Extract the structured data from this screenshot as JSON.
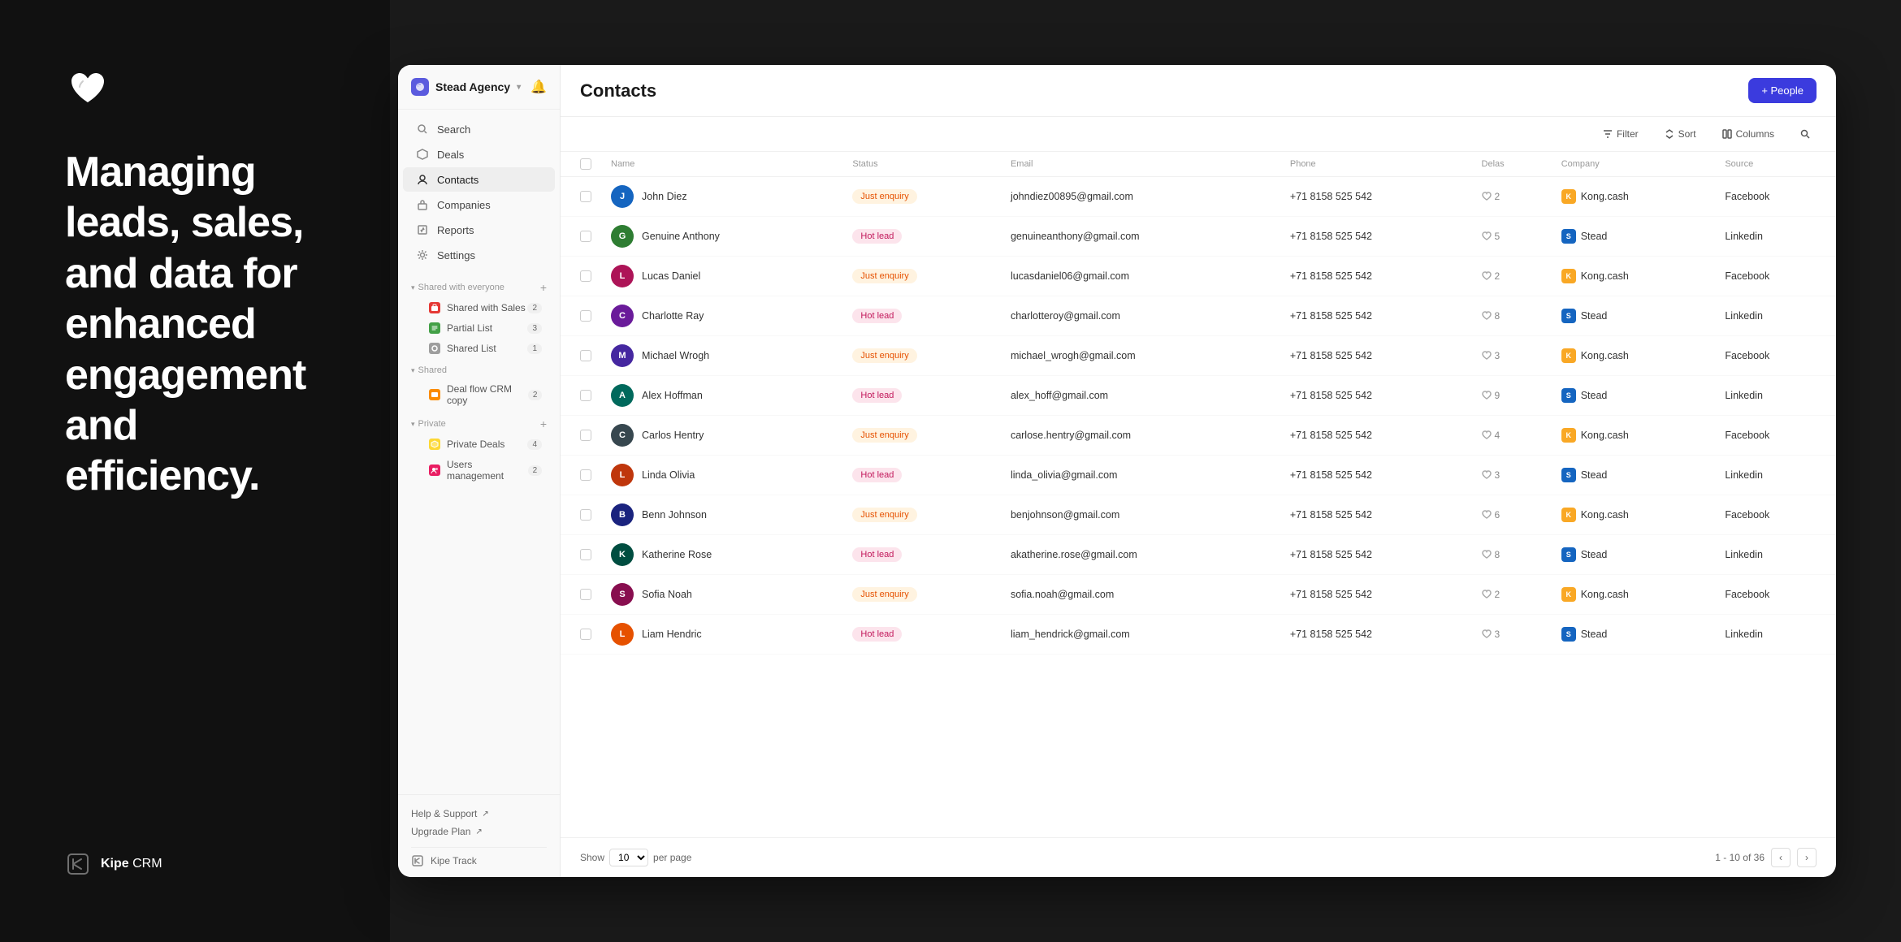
{
  "background": {
    "tagline": "Managing leads, sales, and data for enhanced engagement and efficiency.",
    "brand_name_bold": "Kipe",
    "brand_name_rest": " CRM"
  },
  "sidebar": {
    "brand": "Stead Agency",
    "brand_chevron": "▾",
    "nav_items": [
      {
        "id": "search",
        "label": "Search",
        "icon": "🔍"
      },
      {
        "id": "deals",
        "label": "Deals",
        "icon": "💎"
      },
      {
        "id": "contacts",
        "label": "Contacts",
        "icon": "👤",
        "active": true
      },
      {
        "id": "companies",
        "label": "Companies",
        "icon": "🏢"
      },
      {
        "id": "reports",
        "label": "Reports",
        "icon": "⚙️"
      },
      {
        "id": "settings",
        "label": "Settings",
        "icon": "⚙️"
      }
    ],
    "sections": [
      {
        "id": "shared-everyone",
        "label": "Shared with everyone",
        "items": [
          {
            "id": "shared-with-sales",
            "label": "Shared with Sales",
            "color": "#e53935",
            "badge": "2"
          },
          {
            "id": "partial-list",
            "label": "Partial List",
            "color": "#43a047",
            "badge": "3"
          },
          {
            "id": "shared-list",
            "label": "Shared List",
            "color": "#757575",
            "badge": "1"
          }
        ]
      },
      {
        "id": "shared",
        "label": "Shared",
        "items": [
          {
            "id": "deal-flow-crm",
            "label": "Deal flow CRM copy",
            "color": "#fb8c00",
            "badge": "2"
          }
        ]
      },
      {
        "id": "private",
        "label": "Private",
        "items": [
          {
            "id": "private-deals",
            "label": "Private Deals",
            "color": "#fdd835",
            "badge": "4"
          },
          {
            "id": "users-management",
            "label": "Users management",
            "color": "#e91e63",
            "badge": "2"
          }
        ]
      }
    ],
    "footer_links": [
      {
        "label": "Help & Support",
        "icon": "↗"
      },
      {
        "label": "Upgrade Plan",
        "icon": "↗"
      }
    ],
    "kipe_track_label": "Kipe Track"
  },
  "main": {
    "title": "Contacts",
    "add_button_label": "+ People",
    "toolbar": {
      "filter_label": "Filter",
      "sort_label": "Sort",
      "columns_label": "Columns"
    },
    "table": {
      "columns": [
        "Name",
        "Status",
        "Email",
        "Phone",
        "Delas",
        "Company",
        "Source"
      ],
      "rows": [
        {
          "name": "John Diez",
          "initial": "J",
          "color": "#1565c0",
          "status": "Just enquiry",
          "status_type": "just-enquiry",
          "email": "johndiez00895@gmail.com",
          "phone": "+71 8158 525 542",
          "delas": "2",
          "company": "Kong.cash",
          "company_color": "#f9a825",
          "source": "Facebook"
        },
        {
          "name": "Genuine Anthony",
          "initial": "G",
          "color": "#2e7d32",
          "status": "Hot lead",
          "status_type": "hot-lead",
          "email": "genuineanthony@gmail.com",
          "phone": "+71 8158 525 542",
          "delas": "5",
          "company": "Stead",
          "company_color": "#1565c0",
          "source": "Linkedin"
        },
        {
          "name": "Lucas Daniel",
          "initial": "L",
          "color": "#ad1457",
          "status": "Just enquiry",
          "status_type": "just-enquiry",
          "email": "lucasdaniel06@gmail.com",
          "phone": "+71 8158 525 542",
          "delas": "2",
          "company": "Kong.cash",
          "company_color": "#f9a825",
          "source": "Facebook"
        },
        {
          "name": "Charlotte Ray",
          "initial": "C",
          "color": "#6a1b9a",
          "status": "Hot lead",
          "status_type": "hot-lead",
          "email": "charlotteroy@gmail.com",
          "phone": "+71 8158 525 542",
          "delas": "8",
          "company": "Stead",
          "company_color": "#1565c0",
          "source": "Linkedin"
        },
        {
          "name": "Michael Wrogh",
          "initial": "M",
          "color": "#4527a0",
          "status": "Just enquiry",
          "status_type": "just-enquiry",
          "email": "michael_wrogh@gmail.com",
          "phone": "+71 8158 525 542",
          "delas": "3",
          "company": "Kong.cash",
          "company_color": "#f9a825",
          "source": "Facebook"
        },
        {
          "name": "Alex Hoffman",
          "initial": "A",
          "color": "#00695c",
          "status": "Hot lead",
          "status_type": "hot-lead",
          "email": "alex_hoff@gmail.com",
          "phone": "+71 8158 525 542",
          "delas": "9",
          "company": "Stead",
          "company_color": "#1565c0",
          "source": "Linkedin"
        },
        {
          "name": "Carlos Hentry",
          "initial": "C",
          "color": "#37474f",
          "status": "Just enquiry",
          "status_type": "just-enquiry",
          "email": "carlose.hentry@gmail.com",
          "phone": "+71 8158 525 542",
          "delas": "4",
          "company": "Kong.cash",
          "company_color": "#f9a825",
          "source": "Facebook"
        },
        {
          "name": "Linda Olivia",
          "initial": "L",
          "color": "#bf360c",
          "status": "Hot lead",
          "status_type": "hot-lead",
          "email": "linda_olivia@gmail.com",
          "phone": "+71 8158 525 542",
          "delas": "3",
          "company": "Stead",
          "company_color": "#1565c0",
          "source": "Linkedin"
        },
        {
          "name": "Benn Johnson",
          "initial": "B",
          "color": "#1a237e",
          "status": "Just enquiry",
          "status_type": "just-enquiry",
          "email": "benjohnson@gmail.com",
          "phone": "+71 8158 525 542",
          "delas": "6",
          "company": "Kong.cash",
          "company_color": "#f9a825",
          "source": "Facebook"
        },
        {
          "name": "Katherine Rose",
          "initial": "K",
          "color": "#004d40",
          "status": "Hot lead",
          "status_type": "hot-lead",
          "email": "akatherine.rose@gmail.com",
          "phone": "+71 8158 525 542",
          "delas": "8",
          "company": "Stead",
          "company_color": "#1565c0",
          "source": "Linkedin"
        },
        {
          "name": "Sofia Noah",
          "initial": "S",
          "color": "#880e4f",
          "status": "Just enquiry",
          "status_type": "just-enquiry",
          "email": "sofia.noah@gmail.com",
          "phone": "+71 8158 525 542",
          "delas": "2",
          "company": "Kong.cash",
          "company_color": "#f9a825",
          "source": "Facebook"
        },
        {
          "name": "Liam Hendric",
          "initial": "L",
          "color": "#e65100",
          "status": "Hot lead",
          "status_type": "hot-lead",
          "email": "liam_hendrick@gmail.com",
          "phone": "+71 8158 525 542",
          "delas": "3",
          "company": "Stead",
          "company_color": "#1565c0",
          "source": "Linkedin"
        }
      ]
    },
    "footer": {
      "show_label": "Show",
      "per_page_label": "per page",
      "per_page_value": "10",
      "pagination_info": "1 - 10 of 36"
    }
  }
}
